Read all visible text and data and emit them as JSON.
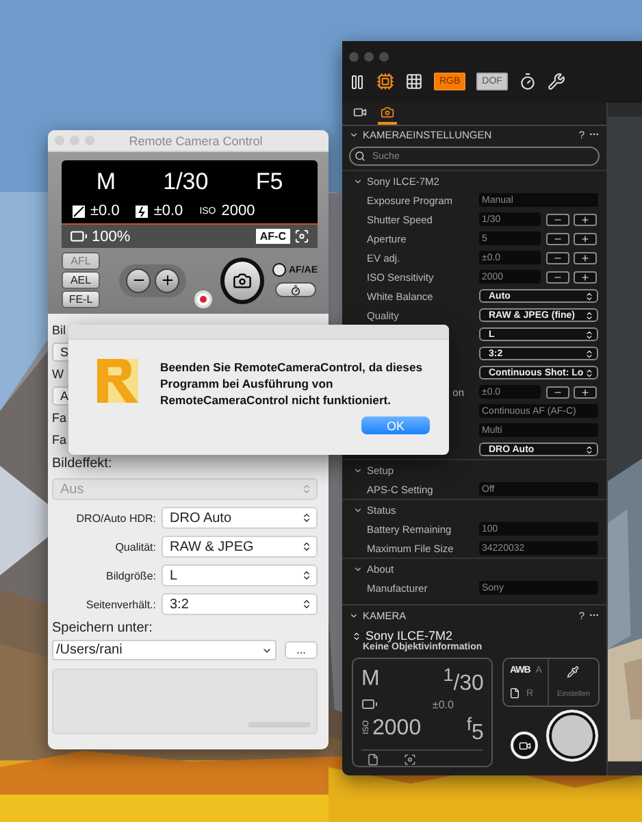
{
  "left_window": {
    "title": "Remote Camera Control",
    "lcd": {
      "mode": "M",
      "shutter": "1/30",
      "aperture": "F5",
      "exposure_comp": "±0.0",
      "flash_comp": "±0.0",
      "iso_label": "ISO",
      "iso": "2000",
      "battery": "100%",
      "focus_badge": "AF-C"
    },
    "lock_buttons": [
      {
        "label": "AFL",
        "disabled": true
      },
      {
        "label": "AEL",
        "disabled": false
      },
      {
        "label": "FE-L",
        "disabled": false
      }
    ],
    "af_ae_label": "AF/AE",
    "af_ae_checked": false,
    "hidden_rows": [
      {
        "kind": "label",
        "text": "Bil"
      },
      {
        "kind": "select",
        "text": "S"
      },
      {
        "kind": "label",
        "text": "W"
      },
      {
        "kind": "select",
        "text": "A"
      },
      {
        "kind": "label",
        "text": "Fa"
      },
      {
        "kind": "label",
        "text": "Fa"
      }
    ],
    "image_effect": {
      "label": "Bildeffekt:",
      "value": "Aus",
      "disabled": true
    },
    "settings": [
      {
        "label": "DRO/Auto HDR:",
        "value": "DRO Auto"
      },
      {
        "label": "Qualität:",
        "value": "RAW & JPEG"
      },
      {
        "label": "Bildgröße:",
        "value": "L"
      },
      {
        "label": "Seitenverhält.:",
        "value": "3:2"
      }
    ],
    "save": {
      "label": "Speichern unter:",
      "path": "/Users/rani",
      "browse": "..."
    }
  },
  "dialog": {
    "message": "Beenden Sie RemoteCameraControl, da dieses Programm bei Ausführung von RemoteCameraControl nicht funktioniert.",
    "button": "OK"
  },
  "right_window": {
    "toggles": [
      {
        "label": "RGB",
        "on": true
      },
      {
        "label": "DOF",
        "on": false
      }
    ],
    "tabs": [
      {
        "kind": "video",
        "selected": false
      },
      {
        "kind": "camera",
        "selected": true
      }
    ],
    "settings_panel": {
      "title": "KAMERAEINSTELLUNGEN",
      "help": "?",
      "search_placeholder": "Suche",
      "groups": [
        {
          "title": "Sony ILCE-7M2",
          "rows": [
            {
              "label": "Exposure Program",
              "value": "Manual",
              "kind": "text"
            },
            {
              "label": "Shutter Speed",
              "value": "1/30",
              "kind": "stepper"
            },
            {
              "label": "Aperture",
              "value": "5",
              "kind": "stepper"
            },
            {
              "label": "EV adj.",
              "value": "±0.0",
              "kind": "stepper"
            },
            {
              "label": "ISO Sensitivity",
              "value": "2000",
              "kind": "stepper"
            },
            {
              "label": "White Balance",
              "value": "Auto",
              "kind": "select"
            },
            {
              "label": "Quality",
              "value": "RAW & JPEG (fine)",
              "kind": "select"
            },
            {
              "value": "L",
              "kind": "select"
            },
            {
              "value": "3:2",
              "kind": "select"
            },
            {
              "value": "Continuous Shot: Lo",
              "kind": "select"
            },
            {
              "label": "on",
              "label_cut": true,
              "value": "±0.0",
              "kind": "stepper"
            },
            {
              "value": "Continuous AF (AF-C)",
              "kind": "text"
            },
            {
              "value": "Multi",
              "kind": "text"
            },
            {
              "value": "DRO Auto",
              "kind": "select"
            }
          ]
        },
        {
          "title": "Setup",
          "rows": [
            {
              "label": "APS-C Setting",
              "value": "Off",
              "kind": "text"
            }
          ]
        },
        {
          "title": "Status",
          "rows": [
            {
              "label": "Battery Remaining",
              "value": "100",
              "kind": "text"
            },
            {
              "label": "Maximum File Size",
              "value": "34220032",
              "kind": "text"
            }
          ]
        },
        {
          "title": "About",
          "rows": [
            {
              "label": "Manufacturer",
              "value": "Sony",
              "kind": "text"
            }
          ]
        }
      ]
    },
    "camera_panel": {
      "title": "KAMERA",
      "help": "?",
      "device": "Sony ILCE-7M2",
      "lens": "Keine Objektivinformation",
      "mode": "M",
      "shutter": "$^{1}$/30",
      "ev": "±0.0",
      "iso_label": "ISO",
      "iso": "2000",
      "aperture": "$^{f}$5",
      "wb": "AWB",
      "wb_mode": "A",
      "file_mode": "R",
      "set_label": "Einstellen"
    }
  }
}
